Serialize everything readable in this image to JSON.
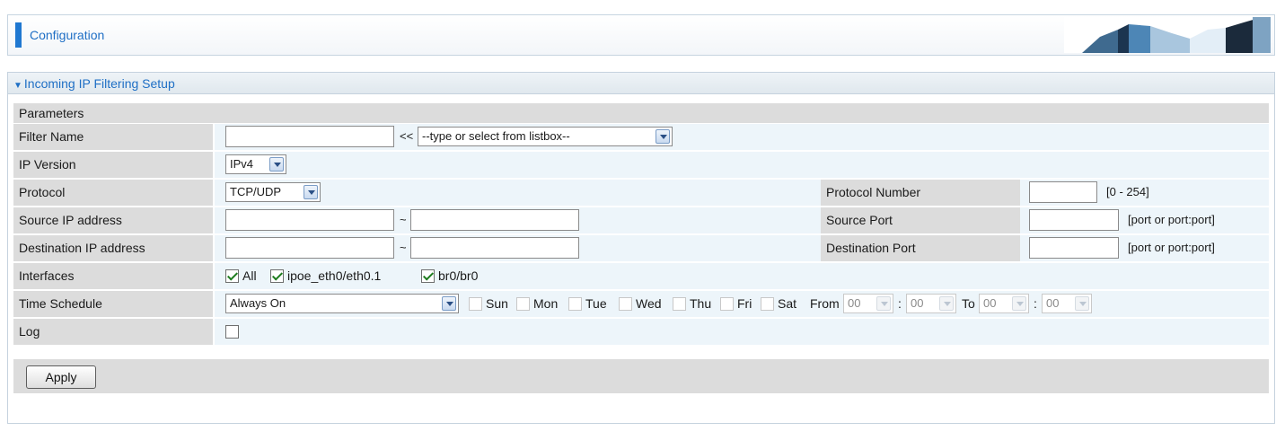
{
  "header": {
    "title": "Configuration"
  },
  "section": {
    "title": "Incoming IP Filtering Setup",
    "params_label": "Parameters"
  },
  "form": {
    "filter_name": {
      "label": "Filter Name",
      "value": "",
      "separator": "<<",
      "select_value": "--type or select from listbox--"
    },
    "ip_version": {
      "label": "IP Version",
      "value": "IPv4"
    },
    "protocol": {
      "label": "Protocol",
      "value": "TCP/UDP",
      "number_label": "Protocol Number",
      "number_value": "",
      "number_hint": "[0 - 254]"
    },
    "source_ip": {
      "label": "Source IP address",
      "from": "",
      "separator": "~",
      "to": "",
      "port_label": "Source Port",
      "port_value": "",
      "port_hint": "[port or port:port]"
    },
    "dest_ip": {
      "label": "Destination IP address",
      "from": "",
      "separator": "~",
      "to": "",
      "port_label": "Destination Port",
      "port_value": "",
      "port_hint": "[port or port:port]"
    },
    "interfaces": {
      "label": "Interfaces",
      "items": [
        {
          "label": "All",
          "checked": true
        },
        {
          "label": "ipoe_eth0/eth0.1",
          "checked": true
        },
        {
          "label": "br0/br0",
          "checked": true
        }
      ]
    },
    "schedule": {
      "label": "Time Schedule",
      "value": "Always On",
      "days": [
        "Sun",
        "Mon",
        "Tue",
        "Wed",
        "Thu",
        "Fri",
        "Sat"
      ],
      "from_label": "From",
      "from_hour": "00",
      "from_min": "00",
      "to_label": "To",
      "to_hour": "00",
      "to_min": "00",
      "colon": ":"
    },
    "log": {
      "label": "Log",
      "checked": false
    }
  },
  "actions": {
    "apply": "Apply"
  },
  "colors": {
    "accent": "#1f78d1",
    "link_text": "#1f6fc5",
    "label_bg": "#dcdcdc",
    "value_bg": "#edf5fa"
  }
}
